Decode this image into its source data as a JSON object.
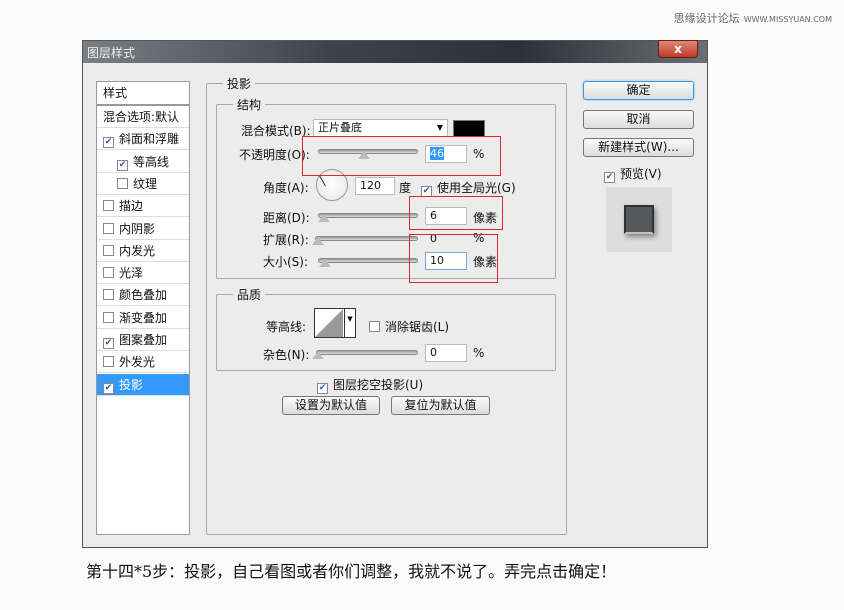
{
  "watermark": {
    "site": "思缘设计论坛",
    "url": "WWW.MISSYUAN.COM"
  },
  "dialog": {
    "title": "图层样式",
    "close": "x"
  },
  "styles_panel": {
    "header": "样式",
    "items": [
      {
        "label": "混合选项:默认",
        "checkbox": false
      },
      {
        "label": "斜面和浮雕",
        "checked": true
      },
      {
        "label": "等高线",
        "checked": true,
        "indent": true
      },
      {
        "label": "纹理",
        "checked": false,
        "indent": true
      },
      {
        "label": "描边",
        "checked": false
      },
      {
        "label": "内阴影",
        "checked": false
      },
      {
        "label": "内发光",
        "checked": false
      },
      {
        "label": "光泽",
        "checked": false
      },
      {
        "label": "颜色叠加",
        "checked": false
      },
      {
        "label": "渐变叠加",
        "checked": false
      },
      {
        "label": "图案叠加",
        "checked": true
      },
      {
        "label": "外发光",
        "checked": false
      },
      {
        "label": "投影",
        "checked": true,
        "selected": true
      }
    ]
  },
  "drop_shadow": {
    "title": "投影",
    "structure": {
      "title": "结构",
      "blend_mode_label": "混合模式(B):",
      "blend_mode": "正片叠底",
      "color": "#000000",
      "opacity_label": "不透明度(O):",
      "opacity": "46",
      "opacity_unit": "%",
      "angle_label": "角度(A):",
      "angle": "120",
      "angle_unit": "度",
      "global_light": "使用全局光(G)",
      "distance_label": "距离(D):",
      "distance": "6",
      "distance_unit": "像素",
      "spread_label": "扩展(R):",
      "spread": "0",
      "spread_unit": "%",
      "size_label": "大小(S):",
      "size": "10",
      "size_unit": "像素"
    },
    "quality": {
      "title": "品质",
      "contour_label": "等高线:",
      "antialias": "消除锯齿(L)",
      "noise_label": "杂色(N):",
      "noise": "0",
      "noise_unit": "%"
    },
    "knockout": "图层挖空投影(U)",
    "make_default": "设置为默认值",
    "reset_default": "复位为默认值"
  },
  "buttons": {
    "ok": "确定",
    "cancel": "取消",
    "new_style": "新建样式(W)...",
    "preview": "预览(V)"
  },
  "caption": "第十四*5步：投影，自己看图或者你们调整，我就不说了。弄完点击确定！"
}
